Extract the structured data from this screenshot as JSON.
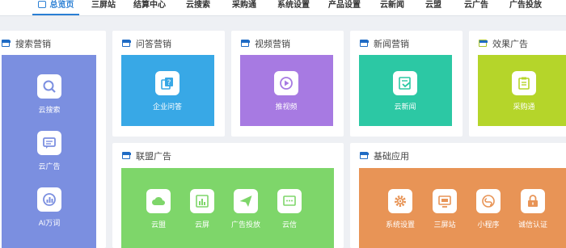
{
  "nav": {
    "items": [
      {
        "label": "总览页",
        "active": true
      },
      {
        "label": "三屏站"
      },
      {
        "label": "结算中心"
      },
      {
        "label": "云搜索"
      },
      {
        "label": "采购通"
      },
      {
        "label": "系统设置"
      },
      {
        "label": "产品设置"
      },
      {
        "label": "云新闻"
      },
      {
        "label": "云盟"
      },
      {
        "label": "云广告"
      },
      {
        "label": "广告投放"
      }
    ]
  },
  "colors": {
    "search": "#7b8fe0",
    "qa": "#38a8e6",
    "video": "#a77ae2",
    "news": "#2cc8a4",
    "effect": "#b5d52a",
    "alliance": "#7ed66a",
    "basic": "#e89456",
    "accent": "#2a7fd4"
  },
  "cards": {
    "search": {
      "title": "搜索营销",
      "tiles": [
        {
          "label": "云搜索",
          "icon": "search-icon"
        },
        {
          "label": "云广告",
          "icon": "chat-icon"
        },
        {
          "label": "AI万词",
          "icon": "bar-chart-icon"
        }
      ]
    },
    "qa": {
      "title": "问答营销",
      "tiles": [
        {
          "label": "企业问答",
          "icon": "question-icon"
        }
      ]
    },
    "video": {
      "title": "视频营销",
      "tiles": [
        {
          "label": "推视频",
          "icon": "play-icon"
        }
      ]
    },
    "news": {
      "title": "新闻营销",
      "tiles": [
        {
          "label": "云新闻",
          "icon": "news-icon"
        }
      ]
    },
    "effect": {
      "title": "效果广告",
      "tiles": [
        {
          "label": "采购通",
          "icon": "clipboard-icon"
        }
      ]
    },
    "alliance": {
      "title": "联盟广告",
      "tiles": [
        {
          "label": "云盟",
          "icon": "cloud-icon"
        },
        {
          "label": "云屏",
          "icon": "screen-chart-icon"
        },
        {
          "label": "广告投放",
          "icon": "send-icon"
        },
        {
          "label": "云信",
          "icon": "message-icon"
        }
      ]
    },
    "basic": {
      "title": "基础应用",
      "tiles": [
        {
          "label": "系统设置",
          "icon": "gear-icon"
        },
        {
          "label": "三屏站",
          "icon": "monitor-icon"
        },
        {
          "label": "小程序",
          "icon": "mini-program-icon"
        },
        {
          "label": "诚信认证",
          "icon": "lock-icon"
        }
      ]
    }
  }
}
